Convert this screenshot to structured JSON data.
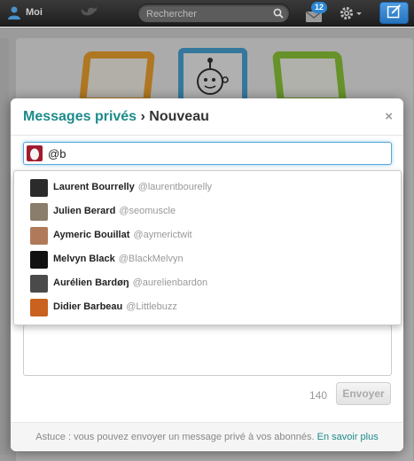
{
  "topbar": {
    "me_label": "Moi",
    "search_placeholder": "Rechercher",
    "dm_badge": "12"
  },
  "modal": {
    "title_link": "Messages privés",
    "title_sep": " › ",
    "title_rest": "Nouveau",
    "close": "×",
    "recipient_value": "@b",
    "counter": "140",
    "send_label": "Envoyer",
    "footer_text": "Astuce : vous pouvez envoyer un message privé à vos abonnés.",
    "footer_link": "En savoir plus"
  },
  "suggestions": [
    {
      "name": "Laurent Bourrelly",
      "handle": "@laurentbourelly",
      "avatar_color": "#2b2b2b"
    },
    {
      "name": "Julien Berard",
      "handle": "@seomuscle",
      "avatar_color": "#8a7d6b"
    },
    {
      "name": "Aymeric Bouillat",
      "handle": "@aymerictwit",
      "avatar_color": "#b07a5a"
    },
    {
      "name": "Melvyn Black",
      "handle": "@BlackMelvyn",
      "avatar_color": "#111111"
    },
    {
      "name": "Aurélien Bardøŋ",
      "handle": "@aurelienbardon",
      "avatar_color": "#4a4a4a"
    },
    {
      "name": "Didier Barbeau",
      "handle": "@Littlebuzz",
      "avatar_color": "#c8621e"
    }
  ],
  "colors": {
    "accent": "#1d8a8a",
    "topbar": "#2a2a2a",
    "focus": "#56a9d8"
  }
}
